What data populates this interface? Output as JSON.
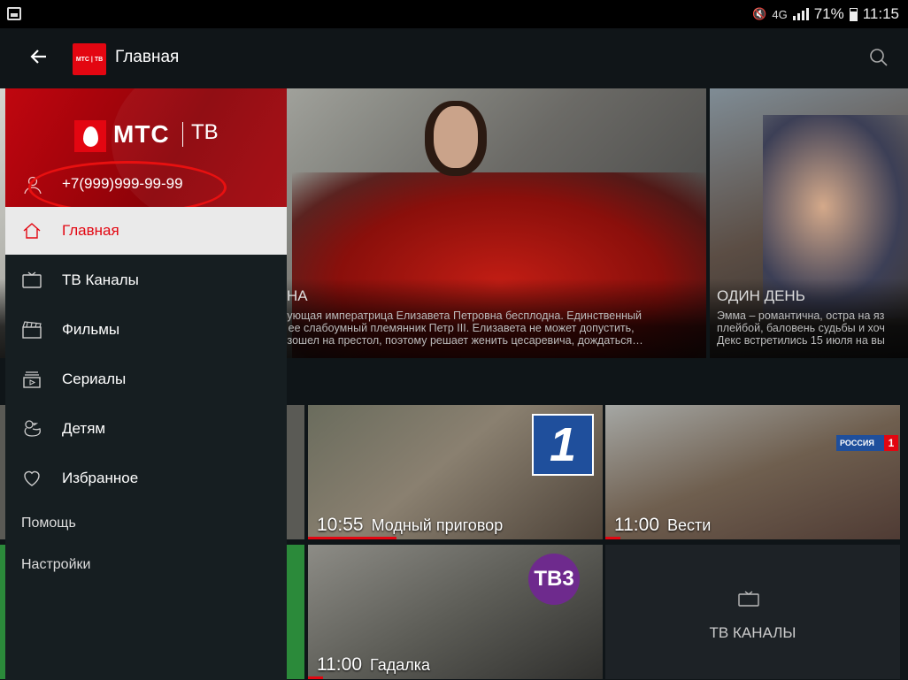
{
  "status_bar": {
    "network_indicator": "4G",
    "battery_percent": "71%",
    "battery_level": 0.71,
    "time": "11:15",
    "icons": [
      "screenshot-icon",
      "mute-icon",
      "signal-icon",
      "battery-icon"
    ]
  },
  "app_bar": {
    "logo_text": "МТС | ТВ",
    "title": "Главная",
    "icons": [
      "back-arrow-icon",
      "search-icon"
    ]
  },
  "drawer": {
    "brand": {
      "name": "МТС",
      "product": "ТВ"
    },
    "phone": "+7(999)999-99-99",
    "menu": [
      {
        "id": "home",
        "label": "Главная",
        "icon": "home-icon",
        "active": true
      },
      {
        "id": "tv-channels",
        "label": "ТВ Каналы",
        "icon": "tv-icon",
        "active": false
      },
      {
        "id": "movies",
        "label": "Фильмы",
        "icon": "clapperboard-icon",
        "active": false
      },
      {
        "id": "series",
        "label": "Сериалы",
        "icon": "series-icon",
        "active": false
      },
      {
        "id": "kids",
        "label": "Детям",
        "icon": "duck-icon",
        "active": false
      },
      {
        "id": "favorites",
        "label": "Избранное",
        "icon": "heart-icon",
        "active": false
      }
    ],
    "secondary": [
      {
        "id": "help",
        "label": "Помощь"
      },
      {
        "id": "settings",
        "label": "Настройки"
      }
    ]
  },
  "banners": [
    {
      "title_fragment": "НА",
      "description": [
        "вующая императрица Елизавета Петровна бесплодна. Единственный",
        "- ее слабоумный племянник Петр III. Елизавета не может допустить,",
        "взошел на престол, поэтому решает женить цесаревича, дождаться…"
      ]
    },
    {
      "title": "ОДИН ДЕНЬ",
      "description": [
        "Эмма – романтична, остра на яз",
        "плейбой, баловень судьбы и хоч",
        "Декс встретились 15 июля на вы"
      ]
    }
  ],
  "tiles": [
    {
      "time": "10:55",
      "program": "Модный приговор",
      "channel_logo": "1",
      "progress": 0.3
    },
    {
      "time": "11:00",
      "program": "Вести",
      "channel_logo": "РОССИЯ 1",
      "progress": 0.05
    },
    {
      "time": "11:00",
      "program": "Гадалка",
      "channel_logo": "ТВ3",
      "progress": 0.05
    },
    {
      "label": "ТВ КАНАЛЫ",
      "icon": "tv-icon"
    }
  ],
  "colors": {
    "brand_red": "#e30611",
    "drawer_bg": "#161e21",
    "active_item_bg": "#eaeaea",
    "annotation_circle": "#e81010"
  }
}
